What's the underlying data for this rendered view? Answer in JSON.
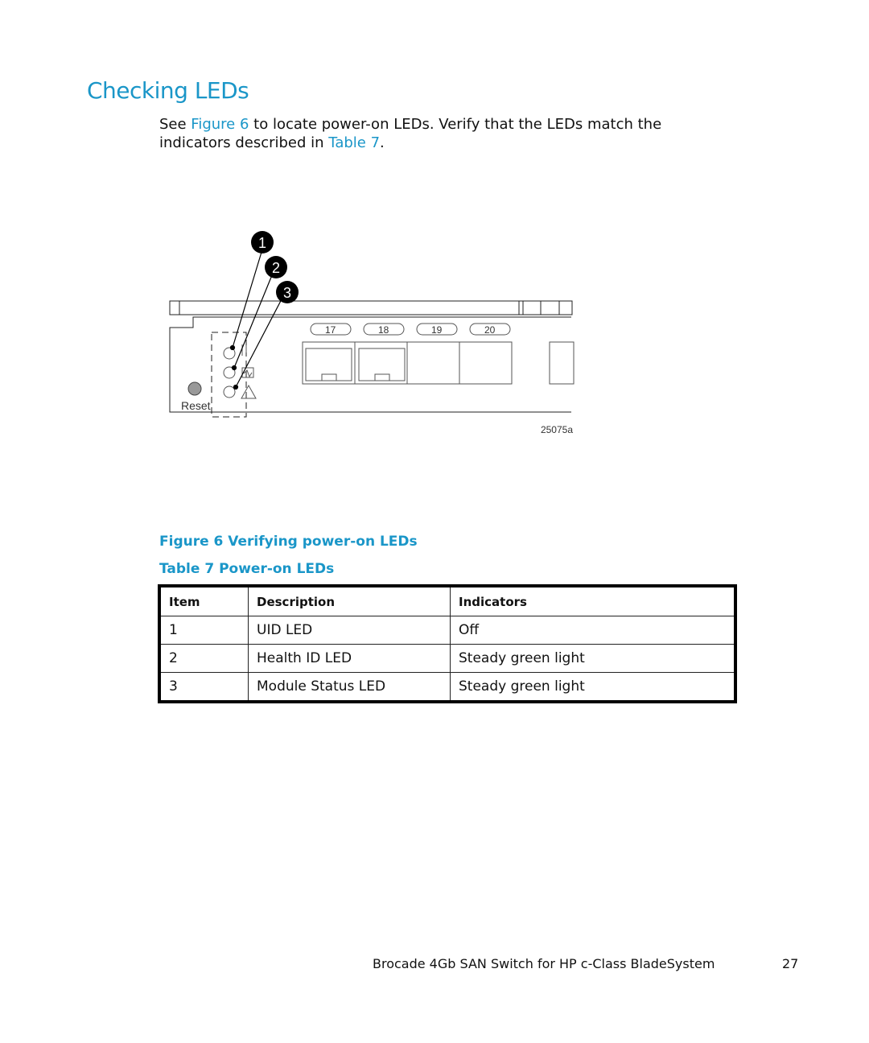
{
  "page": {
    "title": "Checking LEDs",
    "intro": {
      "part1": "See ",
      "figure_link": "Figure 6",
      "part2": " to locate power-on LEDs.  Verify that the LEDs match the indicators described in ",
      "table_link": "Table 7",
      "part3": "."
    },
    "figure": {
      "callouts": [
        "1",
        "2",
        "3"
      ],
      "ports": [
        "17",
        "18",
        "19",
        "20"
      ],
      "reset_label": "Reset",
      "figure_id": "25075a",
      "caption": "Figure 6 Verifying power-on LEDs"
    },
    "table": {
      "caption": "Table 7 Power-on LEDs",
      "headers": [
        "Item",
        "Description",
        "Indicators"
      ],
      "rows": [
        [
          "1",
          "UID LED",
          "Off"
        ],
        [
          "2",
          "Health ID LED",
          "Steady green light"
        ],
        [
          "3",
          "Module Status LED",
          "Steady green light"
        ]
      ]
    },
    "footer": {
      "doc_title": "Brocade 4Gb SAN Switch for HP c-Class BladeSystem",
      "page_number": "27"
    },
    "colors": {
      "accent": "#1a96c8",
      "text": "#111111"
    }
  }
}
